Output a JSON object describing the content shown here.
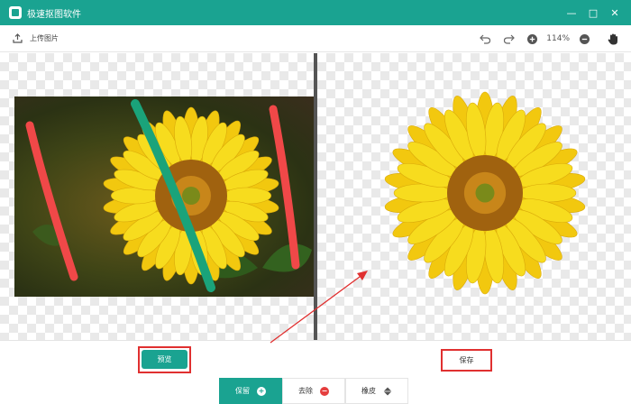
{
  "app": {
    "title": "极速抠图软件"
  },
  "window_controls": {
    "minimize": "—",
    "maximize": "□",
    "close": "✕"
  },
  "toolbar": {
    "upload_label": "上传图片",
    "zoom": "114%"
  },
  "actions": {
    "preview_label": "预览",
    "save_label": "保存"
  },
  "modes": [
    {
      "label": "保留",
      "icon": "plus-circle-icon"
    },
    {
      "label": "去除",
      "icon": "minus-circle-icon"
    },
    {
      "label": "橡皮",
      "icon": "eraser-icon"
    }
  ],
  "colors": {
    "accent": "#1aa391",
    "keep_stroke": "#1aa37a",
    "remove_stroke": "#f04848",
    "highlight": "#e03030"
  }
}
